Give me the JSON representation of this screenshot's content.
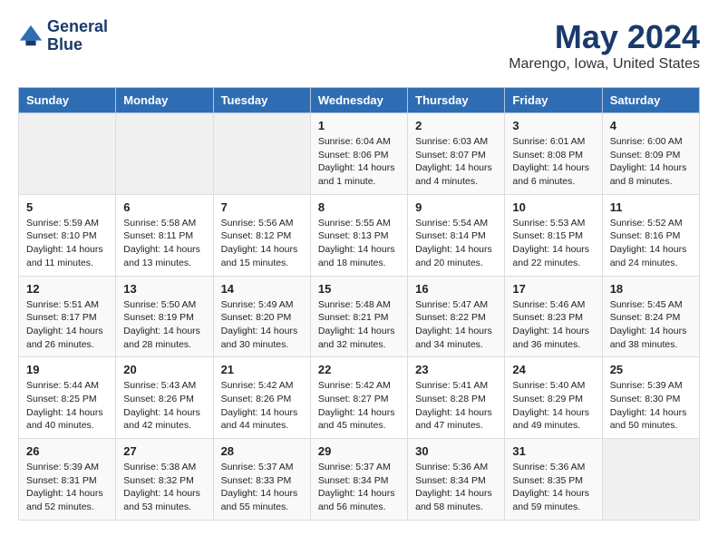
{
  "logo": {
    "line1": "General",
    "line2": "Blue"
  },
  "title": "May 2024",
  "location": "Marengo, Iowa, United States",
  "days_of_week": [
    "Sunday",
    "Monday",
    "Tuesday",
    "Wednesday",
    "Thursday",
    "Friday",
    "Saturday"
  ],
  "weeks": [
    [
      {
        "num": "",
        "info": ""
      },
      {
        "num": "",
        "info": ""
      },
      {
        "num": "",
        "info": ""
      },
      {
        "num": "1",
        "info": "Sunrise: 6:04 AM\nSunset: 8:06 PM\nDaylight: 14 hours and 1 minute."
      },
      {
        "num": "2",
        "info": "Sunrise: 6:03 AM\nSunset: 8:07 PM\nDaylight: 14 hours and 4 minutes."
      },
      {
        "num": "3",
        "info": "Sunrise: 6:01 AM\nSunset: 8:08 PM\nDaylight: 14 hours and 6 minutes."
      },
      {
        "num": "4",
        "info": "Sunrise: 6:00 AM\nSunset: 8:09 PM\nDaylight: 14 hours and 8 minutes."
      }
    ],
    [
      {
        "num": "5",
        "info": "Sunrise: 5:59 AM\nSunset: 8:10 PM\nDaylight: 14 hours and 11 minutes."
      },
      {
        "num": "6",
        "info": "Sunrise: 5:58 AM\nSunset: 8:11 PM\nDaylight: 14 hours and 13 minutes."
      },
      {
        "num": "7",
        "info": "Sunrise: 5:56 AM\nSunset: 8:12 PM\nDaylight: 14 hours and 15 minutes."
      },
      {
        "num": "8",
        "info": "Sunrise: 5:55 AM\nSunset: 8:13 PM\nDaylight: 14 hours and 18 minutes."
      },
      {
        "num": "9",
        "info": "Sunrise: 5:54 AM\nSunset: 8:14 PM\nDaylight: 14 hours and 20 minutes."
      },
      {
        "num": "10",
        "info": "Sunrise: 5:53 AM\nSunset: 8:15 PM\nDaylight: 14 hours and 22 minutes."
      },
      {
        "num": "11",
        "info": "Sunrise: 5:52 AM\nSunset: 8:16 PM\nDaylight: 14 hours and 24 minutes."
      }
    ],
    [
      {
        "num": "12",
        "info": "Sunrise: 5:51 AM\nSunset: 8:17 PM\nDaylight: 14 hours and 26 minutes."
      },
      {
        "num": "13",
        "info": "Sunrise: 5:50 AM\nSunset: 8:19 PM\nDaylight: 14 hours and 28 minutes."
      },
      {
        "num": "14",
        "info": "Sunrise: 5:49 AM\nSunset: 8:20 PM\nDaylight: 14 hours and 30 minutes."
      },
      {
        "num": "15",
        "info": "Sunrise: 5:48 AM\nSunset: 8:21 PM\nDaylight: 14 hours and 32 minutes."
      },
      {
        "num": "16",
        "info": "Sunrise: 5:47 AM\nSunset: 8:22 PM\nDaylight: 14 hours and 34 minutes."
      },
      {
        "num": "17",
        "info": "Sunrise: 5:46 AM\nSunset: 8:23 PM\nDaylight: 14 hours and 36 minutes."
      },
      {
        "num": "18",
        "info": "Sunrise: 5:45 AM\nSunset: 8:24 PM\nDaylight: 14 hours and 38 minutes."
      }
    ],
    [
      {
        "num": "19",
        "info": "Sunrise: 5:44 AM\nSunset: 8:25 PM\nDaylight: 14 hours and 40 minutes."
      },
      {
        "num": "20",
        "info": "Sunrise: 5:43 AM\nSunset: 8:26 PM\nDaylight: 14 hours and 42 minutes."
      },
      {
        "num": "21",
        "info": "Sunrise: 5:42 AM\nSunset: 8:26 PM\nDaylight: 14 hours and 44 minutes."
      },
      {
        "num": "22",
        "info": "Sunrise: 5:42 AM\nSunset: 8:27 PM\nDaylight: 14 hours and 45 minutes."
      },
      {
        "num": "23",
        "info": "Sunrise: 5:41 AM\nSunset: 8:28 PM\nDaylight: 14 hours and 47 minutes."
      },
      {
        "num": "24",
        "info": "Sunrise: 5:40 AM\nSunset: 8:29 PM\nDaylight: 14 hours and 49 minutes."
      },
      {
        "num": "25",
        "info": "Sunrise: 5:39 AM\nSunset: 8:30 PM\nDaylight: 14 hours and 50 minutes."
      }
    ],
    [
      {
        "num": "26",
        "info": "Sunrise: 5:39 AM\nSunset: 8:31 PM\nDaylight: 14 hours and 52 minutes."
      },
      {
        "num": "27",
        "info": "Sunrise: 5:38 AM\nSunset: 8:32 PM\nDaylight: 14 hours and 53 minutes."
      },
      {
        "num": "28",
        "info": "Sunrise: 5:37 AM\nSunset: 8:33 PM\nDaylight: 14 hours and 55 minutes."
      },
      {
        "num": "29",
        "info": "Sunrise: 5:37 AM\nSunset: 8:34 PM\nDaylight: 14 hours and 56 minutes."
      },
      {
        "num": "30",
        "info": "Sunrise: 5:36 AM\nSunset: 8:34 PM\nDaylight: 14 hours and 58 minutes."
      },
      {
        "num": "31",
        "info": "Sunrise: 5:36 AM\nSunset: 8:35 PM\nDaylight: 14 hours and 59 minutes."
      },
      {
        "num": "",
        "info": ""
      }
    ]
  ]
}
